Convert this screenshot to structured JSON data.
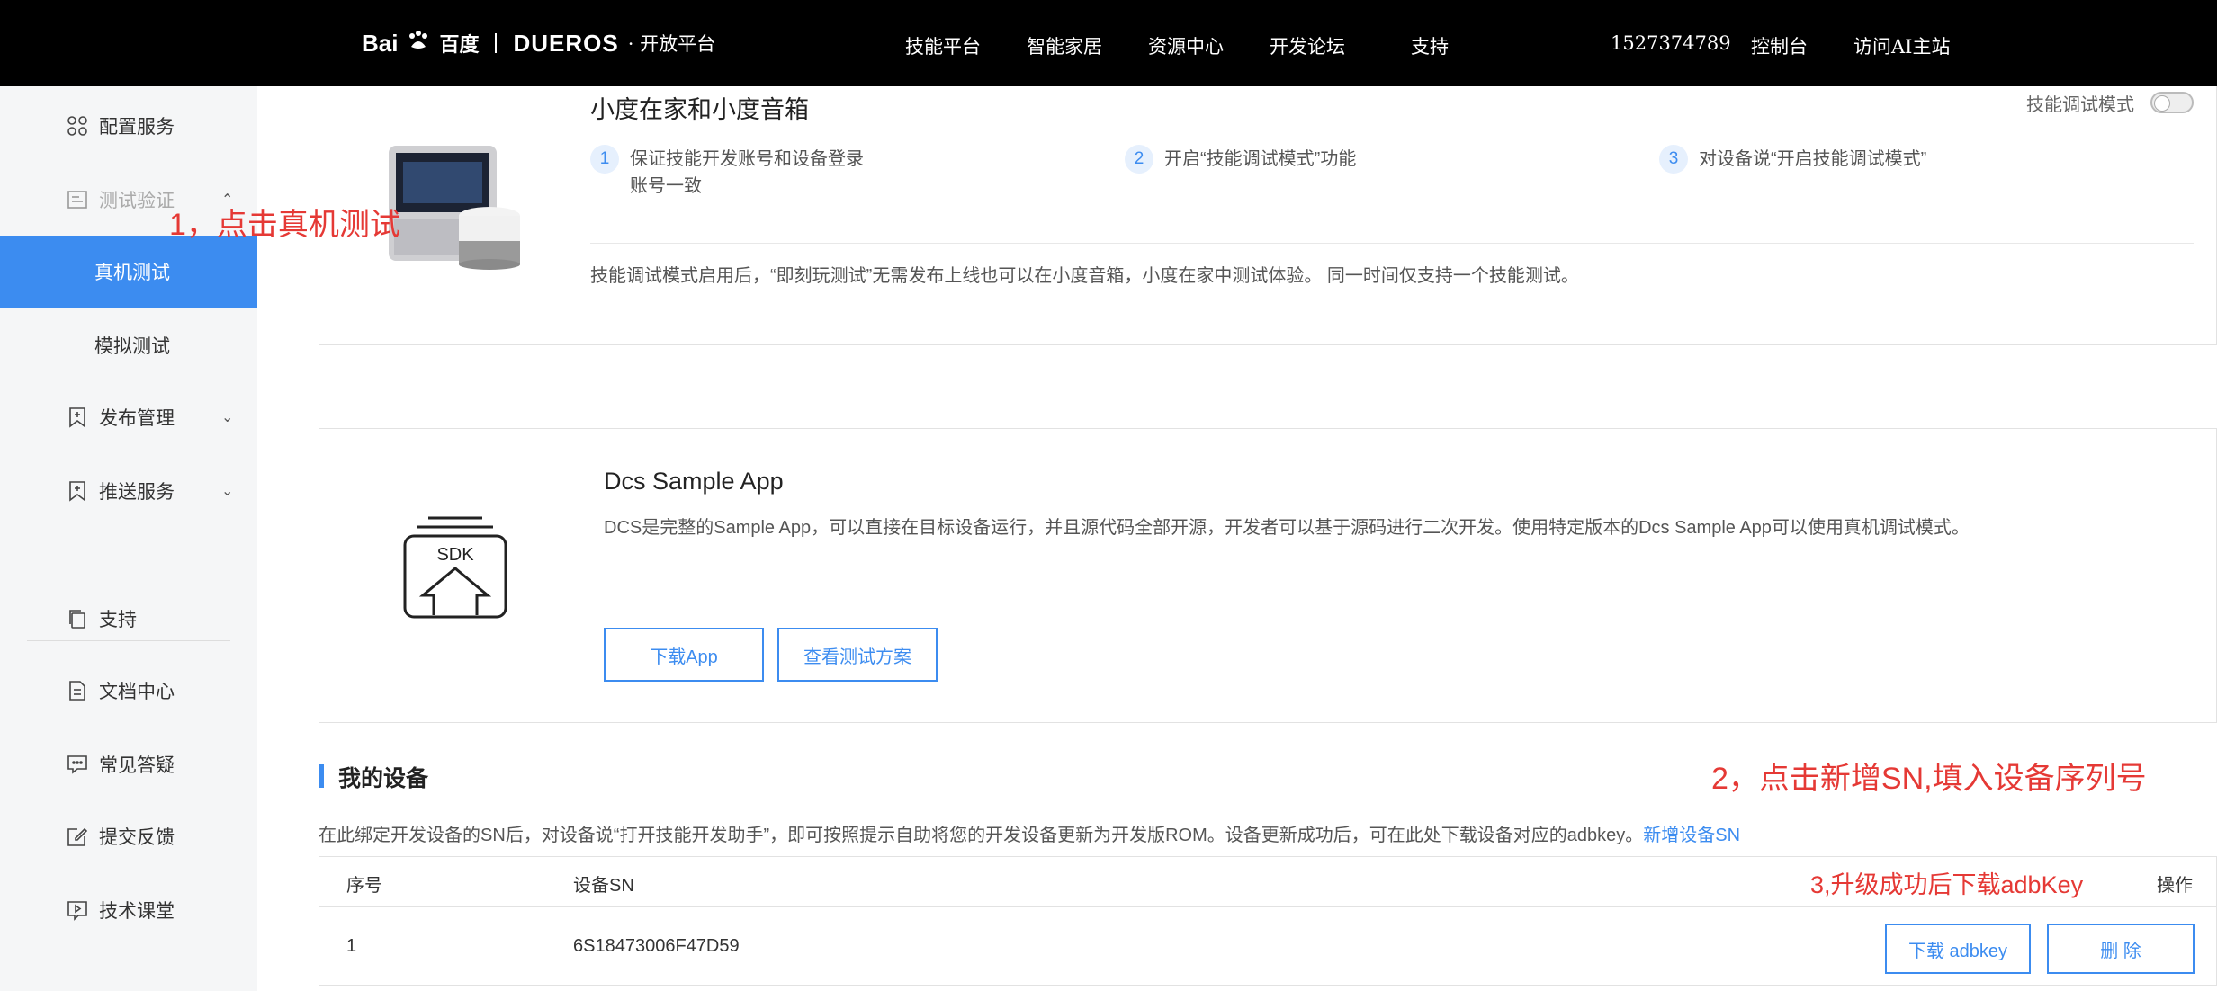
{
  "nav": {
    "logo_baidu": "Bai",
    "logo_baidu_tail": "百度",
    "logo_dueros": "DUEROS",
    "logo_open": "· 开放平台",
    "links": [
      "技能平台",
      "智能家居",
      "资源中心",
      "开发论坛",
      "支持"
    ],
    "account": "1527374789",
    "console": "控制台",
    "visit_ai": "访问AI主站"
  },
  "sidebar": {
    "config": "配置服务",
    "test_verify": "测试验证",
    "real_test": "真机测试",
    "sim_test": "模拟测试",
    "publish": "发布管理",
    "push": "推送服务",
    "support": "支持",
    "docs": "文档中心",
    "faq": "常见答疑",
    "feedback": "提交反馈",
    "classroom": "技术课堂"
  },
  "card1": {
    "title": "小度在家和小度音箱",
    "toggle_label": "技能调试模式",
    "steps": [
      {
        "num": "1",
        "text": "保证技能开发账号和设备登录账号一致"
      },
      {
        "num": "2",
        "text": "开启“技能调试模式”功能"
      },
      {
        "num": "3",
        "text": "对设备说“开启技能调试模式”"
      }
    ],
    "note": "技能调试模式启用后，“即刻玩测试”无需发布上线也可以在小度音箱，小度在家中测试体验。 同一时间仅支持一个技能测试。"
  },
  "card2": {
    "sdk_label": "SDK",
    "title": "Dcs Sample App",
    "desc": "DCS是完整的Sample App，可以直接在目标设备运行，并且源代码全部开源，开发者可以基于源码进行二次开发。使用特定版本的Dcs Sample App可以使用真机调试模式。",
    "download_btn": "下载App",
    "plan_btn": "查看测试方案"
  },
  "devices": {
    "title": "我的设备",
    "desc": "在此绑定开发设备的SN后，对设备说“打开技能开发助手”，即可按照提示自助将您的开发设备更新为开发版ROM。设备更新成功后，可在此处下载设备对应的adbkey。",
    "add_link": "新增设备SN",
    "headers": {
      "index": "序号",
      "sn": "设备SN",
      "ops": "操作"
    },
    "rows": [
      {
        "index": "1",
        "sn": "6S18473006F47D59",
        "download": "下载 adbkey",
        "delete": "删 除"
      }
    ]
  },
  "annotations": {
    "a1": "1，点击真机测试",
    "a2": "2，点击新增SN,填入设备序列号",
    "a3": "3,升级成功后下载adbKey"
  },
  "colors": {
    "accent": "#3c8cf0",
    "annotation": "#e53935",
    "nav_bg": "#000000"
  }
}
